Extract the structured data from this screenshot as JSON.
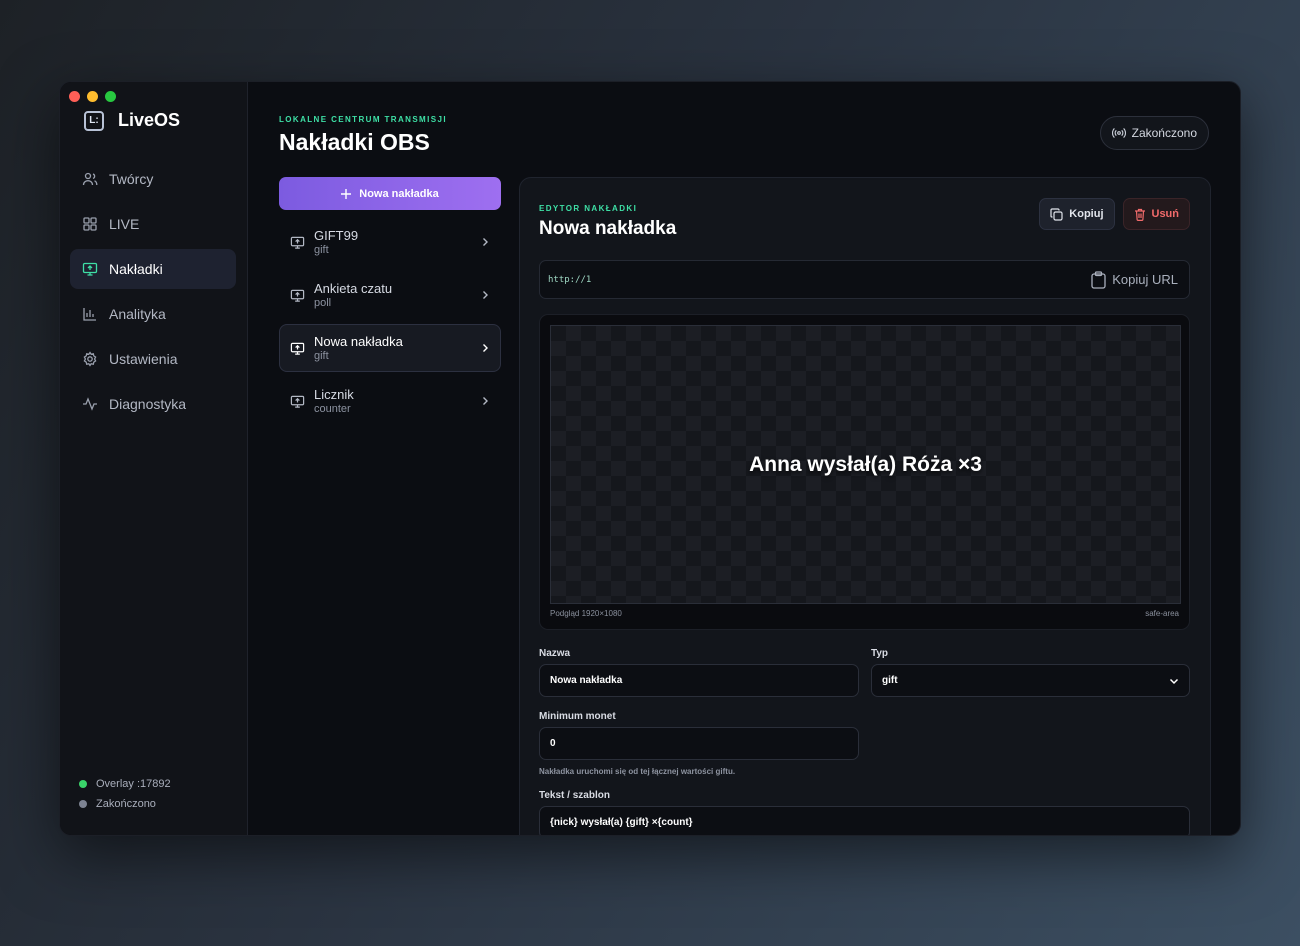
{
  "app": {
    "name": "LiveOS",
    "logo_glyph": "L:"
  },
  "sidebar": {
    "items": [
      {
        "label": "Twórcy",
        "icon": "users-icon",
        "active": false
      },
      {
        "label": "LIVE",
        "icon": "grid-icon",
        "active": false
      },
      {
        "label": "Nakładki",
        "icon": "monitor-icon",
        "active": true
      },
      {
        "label": "Analityka",
        "icon": "bar-chart-icon",
        "active": false
      },
      {
        "label": "Ustawienia",
        "icon": "gear-icon",
        "active": false
      },
      {
        "label": "Diagnostyka",
        "icon": "activity-icon",
        "active": false
      }
    ],
    "status": [
      {
        "label": "Overlay :17892",
        "color": "#3ad46a"
      },
      {
        "label": "Zakończono",
        "color": "#7d8392"
      }
    ]
  },
  "header": {
    "eyebrow": "LOKALNE CENTRUM TRANSMISJI",
    "title": "Nakładki OBS",
    "status_pill": "Zakończono"
  },
  "list": {
    "new_button": "Nowa nakładka",
    "items": [
      {
        "name": "GIFT99",
        "type": "gift",
        "selected": false
      },
      {
        "name": "Ankieta czatu",
        "type": "poll",
        "selected": false
      },
      {
        "name": "Nowa nakładka",
        "type": "gift",
        "selected": true
      },
      {
        "name": "Licznik",
        "type": "counter",
        "selected": false
      }
    ]
  },
  "editor": {
    "eyebrow": "EDYTOR NAKŁADKI",
    "title": "Nowa nakładka",
    "copy_button": "Kopiuj",
    "delete_button": "Usuń",
    "url": "http://1",
    "copy_url_button": "Kopiuj URL",
    "preview_text": "Anna wysłał(a) Róża ×3",
    "preview_caption": "Podgląd 1920×1080",
    "preview_safe": "safe-area",
    "fields": {
      "name_label": "Nazwa",
      "name_value": "Nowa nakładka",
      "type_label": "Typ",
      "type_value": "gift",
      "min_label": "Minimum monet",
      "min_value": "0",
      "min_hint": "Nakładka uruchomi się od tej łącznej wartości giftu.",
      "text_label": "Tekst / szablon",
      "text_value": "{nick} wysłał(a) {gift} ×{count}"
    }
  },
  "colors": {
    "accent": "#8b63ea",
    "eyebrow": "#3ee0a6",
    "danger": "#f26b6b"
  }
}
